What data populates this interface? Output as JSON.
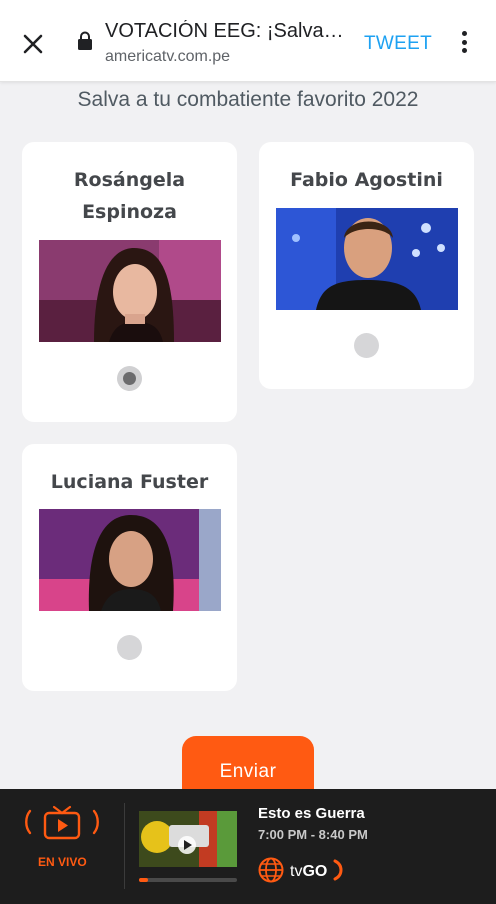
{
  "browser": {
    "title": "VOTACIÓN EEG: ¡Salva…",
    "url": "americatv.com.pe",
    "tweet_label": "TWEET"
  },
  "page": {
    "heading": "Salva a tu combatiente favorito 2022",
    "contestants": [
      {
        "name_line1": "Rosángela",
        "name_line2": "Espinoza",
        "selected": true
      },
      {
        "name": "Fabio Agostini",
        "selected": false
      },
      {
        "name": "Luciana Fuster",
        "selected": false
      }
    ],
    "submit_label": "Enviar"
  },
  "live_bar": {
    "live_label": "EN VIVO",
    "show_title": "Esto es Guerra",
    "show_time": "7:00 PM - 8:40 PM",
    "brand_prefix": "tv",
    "brand_suffix": "GO",
    "progress_fraction": 0.09
  },
  "colors": {
    "accent": "#ff5a12",
    "tweet": "#1da1f2"
  }
}
